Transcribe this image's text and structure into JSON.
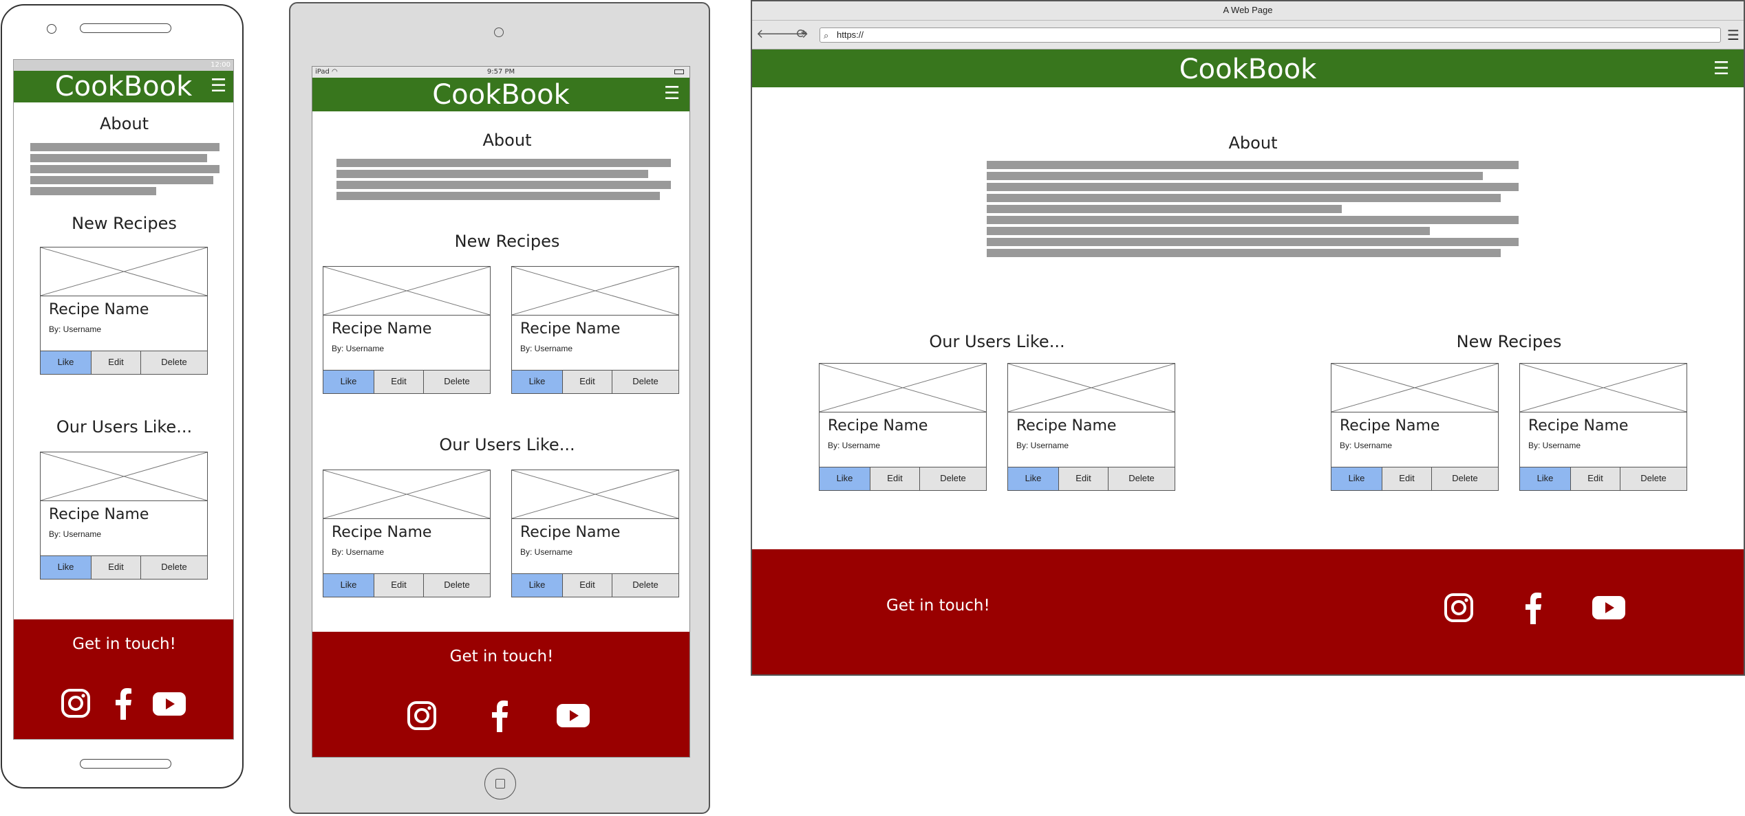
{
  "brand": {
    "name": "CookBook",
    "nav_color": "#38761d",
    "footer_color": "#990000",
    "like_color": "#8fb7f0"
  },
  "phone": {
    "status_text": "12:00"
  },
  "tablet": {
    "carrier": "iPad",
    "time": "9:57 PM"
  },
  "browser": {
    "window_title": "A Web Page",
    "url": "https://"
  },
  "sections": {
    "about": "About",
    "new_recipes": "New Recipes",
    "users_like": "Our Users Like..."
  },
  "card": {
    "recipe_name": "Recipe Name",
    "username": "By: Username",
    "like": "Like",
    "edit": "Edit",
    "delete": "Delete"
  },
  "footer": {
    "cta": "Get in touch!",
    "icons": [
      "instagram-icon",
      "facebook-icon",
      "youtube-icon"
    ]
  }
}
